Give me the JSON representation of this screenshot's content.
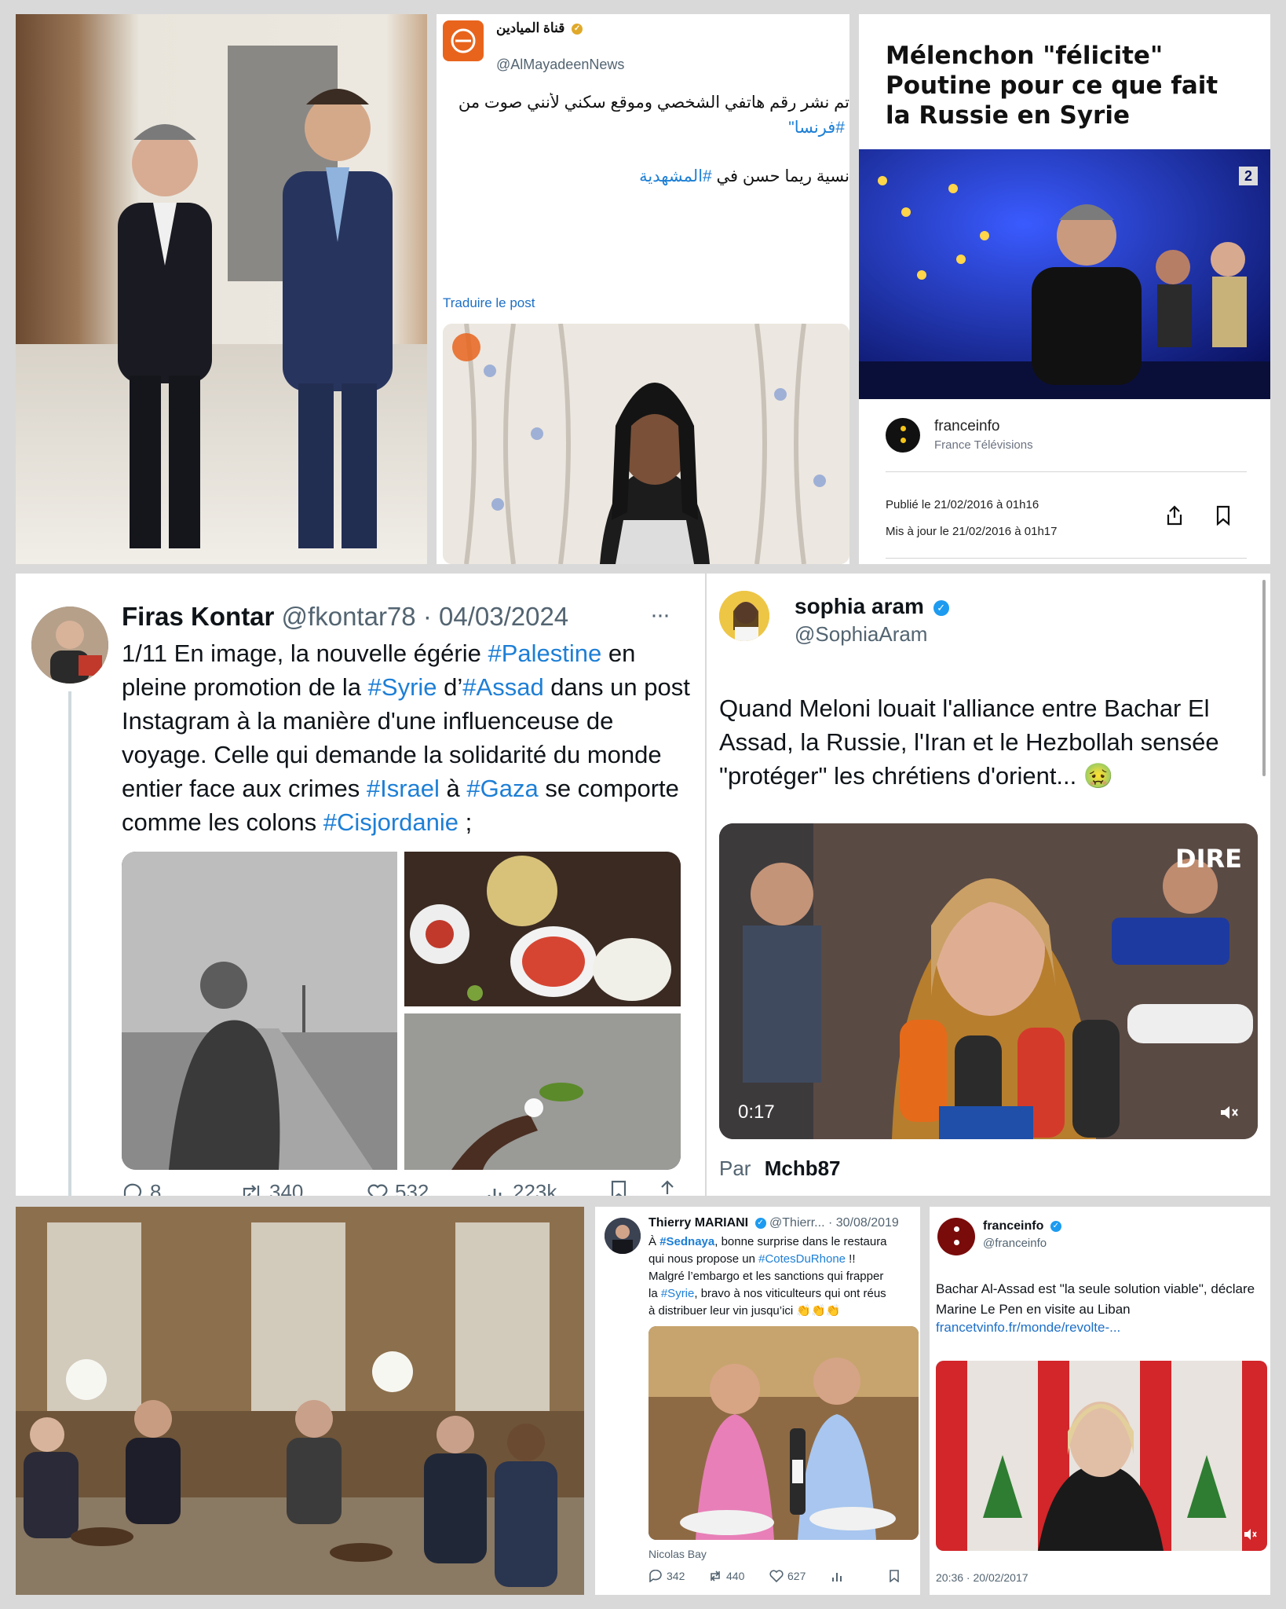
{
  "tile_tl_photo": {
    "alt": "Thierry Mariani and Bashar al-Assad"
  },
  "mayadeen": {
    "name": "قناة الميادين",
    "handle": "@AlMayadeenNews",
    "line1": "تم نشر رقم هاتفي الشخصي وموقع سكني لأنني صوت من",
    "line1_tag": "#فرنسا\"",
    "line2_text": "نسية ريما حسن في",
    "line2_tag": "#المشهدية",
    "translate": "Traduire le post"
  },
  "franceinfo_article": {
    "title": "Mélenchon \"félicite\" Poutine pour ce que fait la Russie en Syrie",
    "source": "franceinfo",
    "source_sub": "France Télévisions",
    "published": "Publié le 21/02/2016 à 01h16",
    "updated": "Mis à jour le 21/02/2016 à 01h17",
    "channel_badge": "2"
  },
  "kontar": {
    "name": "Firas Kontar",
    "handle": "@fkontar78",
    "date": "04/03/2024",
    "more": "···",
    "t1": "1/11 En image, la nouvelle égérie ",
    "h1": "#Palestine",
    "t2": " en pleine promotion de la ",
    "h2": "#Syrie",
    "t3": " d’",
    "h3": "#Assad",
    "t4": " dans un post Instagram à la manière d'une influenceuse de voyage. Celle qui demande la solidarité du monde entier face aux crimes ",
    "h4": "#Israel",
    "t5": " à ",
    "h5": "#Gaza",
    "t6": " se comporte comme les colons ",
    "h6": "#Cisjordanie",
    "t7": " ;",
    "stats": {
      "replies": "8",
      "reposts": "340",
      "likes": "532",
      "views": "223k"
    }
  },
  "aram": {
    "name": "sophia aram",
    "handle": "@SophiaAram",
    "text": "Quand Meloni louait l'alliance entre Bachar El Assad, la Russie, l'Iran et le Hezbollah sensée \"protéger\" les chrétiens d'orient...",
    "emoji": "🤢",
    "duration": "0:17",
    "brand": "DIRE",
    "par_label": "Par",
    "par_name": "Mchb87"
  },
  "mariani": {
    "name": "Thierry MARIANI",
    "handle": "@Thierr...",
    "date": "30/08/2019",
    "l1a": "À ",
    "l1tag": "#Sednaya",
    "l1b": ", bonne surprise dans le restaura",
    "l2a": "qui nous propose un ",
    "l2tag": "#CotesDuRhone",
    "l2b": " !!",
    "l3": "Malgré l’embargo et les sanctions  qui frapper",
    "l4a": "la ",
    "l4tag": "#Syrie",
    "l4b": ", bravo à nos viticulteurs qui ont réus",
    "l5": "à distribuer leur vin jusqu’ici 👏👏👏",
    "caption": "Nicolas Bay",
    "stats": {
      "replies": "342",
      "reposts": "440",
      "likes": "627"
    }
  },
  "franceinfo_tweet": {
    "name": "franceinfo",
    "handle": "@franceinfo",
    "text": "Bachar Al-Assad est \"la seule solution viable\", déclare Marine Le Pen en visite au Liban",
    "link": "francetvinfo.fr/monde/revolte-...",
    "time": "20:36 · 20/02/2017"
  }
}
